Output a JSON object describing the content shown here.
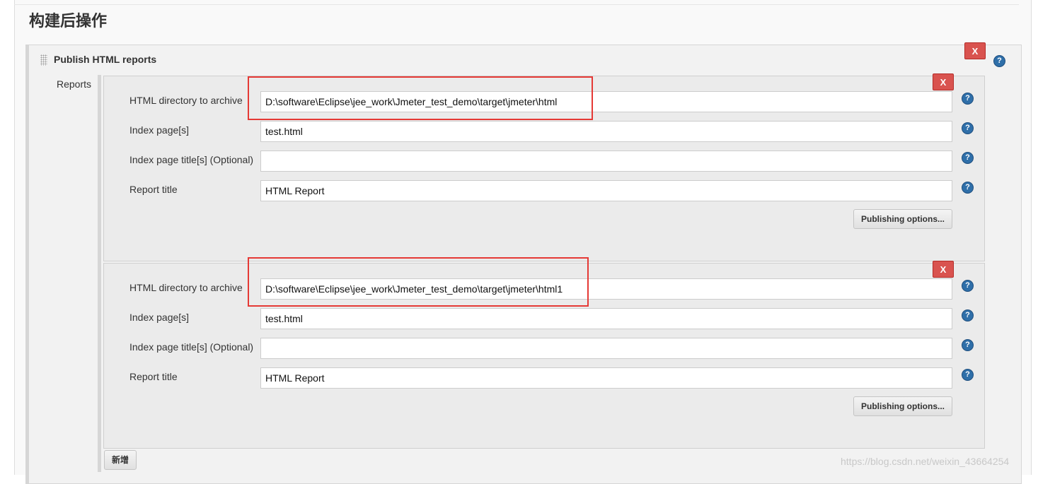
{
  "section": {
    "title": "构建后操作"
  },
  "step": {
    "title": "Publish HTML reports",
    "reports_label": "Reports",
    "delete_label": "X",
    "help_label": "?"
  },
  "reports": [
    {
      "delete_label": "X",
      "fields": [
        {
          "label": "HTML directory to archive",
          "value": "D:\\software\\Eclipse\\jee_work\\Jmeter_test_demo\\target\\jmeter\\html"
        },
        {
          "label": "Index page[s]",
          "value": "test.html"
        },
        {
          "label": "Index page title[s] (Optional)",
          "value": ""
        },
        {
          "label": "Report title",
          "value": "HTML Report"
        }
      ],
      "publishing_options_label": "Publishing options..."
    },
    {
      "delete_label": "X",
      "fields": [
        {
          "label": "HTML directory to archive",
          "value": "D:\\software\\Eclipse\\jee_work\\Jmeter_test_demo\\target\\jmeter\\html1"
        },
        {
          "label": "Index page[s]",
          "value": "test.html"
        },
        {
          "label": "Index page title[s] (Optional)",
          "value": ""
        },
        {
          "label": "Report title",
          "value": "HTML Report"
        }
      ],
      "publishing_options_label": "Publishing options..."
    }
  ],
  "add_button_label": "新增",
  "watermark": "https://blog.csdn.net/weixin_43664254",
  "colors": {
    "delete": "#d9534f",
    "help": "#2f6fa9",
    "highlight": "#e53935"
  }
}
